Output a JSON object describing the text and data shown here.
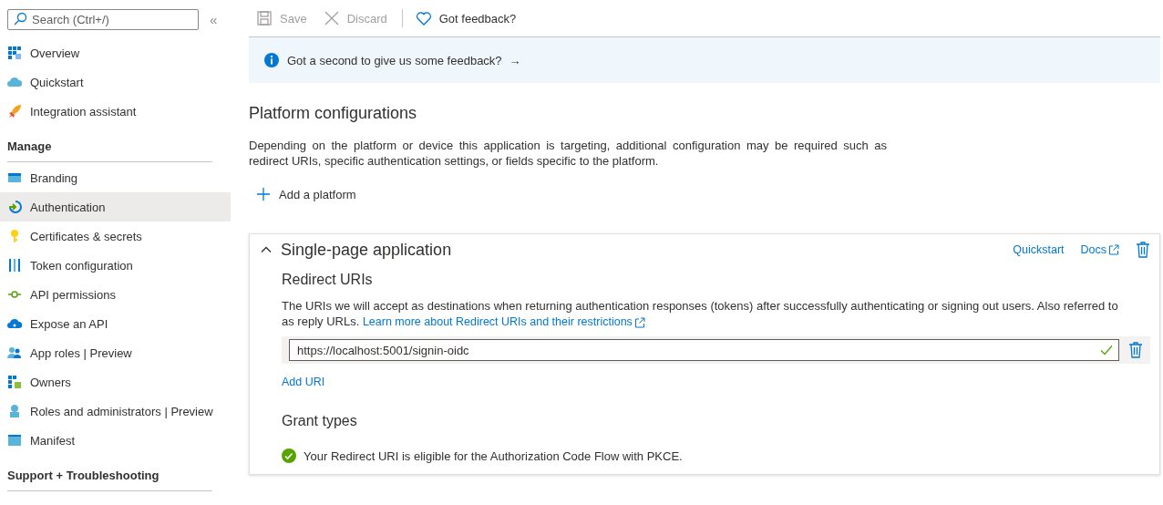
{
  "sidebar": {
    "search": {
      "placeholder": "Search (Ctrl+/)"
    },
    "collapse": "«",
    "groups": [
      {
        "items": [
          {
            "label": "Overview",
            "selected": false
          },
          {
            "label": "Quickstart",
            "selected": false
          },
          {
            "label": "Integration assistant",
            "selected": false
          }
        ]
      },
      {
        "heading": "Manage",
        "items": [
          {
            "label": "Branding",
            "selected": false
          },
          {
            "label": "Authentication",
            "selected": true
          },
          {
            "label": "Certificates & secrets",
            "selected": false
          },
          {
            "label": "Token configuration",
            "selected": false
          },
          {
            "label": "API permissions",
            "selected": false
          },
          {
            "label": "Expose an API",
            "selected": false
          },
          {
            "label": "App roles | Preview",
            "selected": false
          },
          {
            "label": "Owners",
            "selected": false
          },
          {
            "label": "Roles and administrators | Preview",
            "selected": false
          },
          {
            "label": "Manifest",
            "selected": false
          }
        ]
      },
      {
        "heading": "Support + Troubleshooting"
      }
    ]
  },
  "toolbar": {
    "buttons": [
      {
        "label": "Save",
        "disabled": true
      },
      {
        "label": "Discard",
        "disabled": true
      },
      {
        "label": "Got feedback?",
        "disabled": false
      }
    ]
  },
  "banner": {
    "text": "Got a second to give us some feedback?",
    "arrow": "→"
  },
  "page": {
    "title": "Platform configurations",
    "description": "Depending on the platform or device this application is targeting, additional configuration may be required such as redirect URIs, specific authentication settings, or fields specific to the platform.",
    "add_platform": "Add a platform"
  },
  "platform_card": {
    "title": "Single-page application",
    "expanded": true,
    "links": [
      "Quickstart",
      "Docs"
    ],
    "redirect": {
      "heading": "Redirect URIs",
      "description": "The URIs we will accept as destinations when returning authentication responses (tokens) after successfully authenticating or signing out users. Also referred to as reply URLs.",
      "learn_more": "Learn more about Redirect URIs and their restrictions",
      "uris": [
        {
          "value": "https://localhost:5001/signin-oidc",
          "valid": true
        }
      ],
      "add_uri": "Add URI"
    },
    "grant": {
      "heading": "Grant types",
      "message": "Your Redirect URI is eligible for the Authorization Code Flow with PKCE.",
      "eligible": true
    }
  }
}
